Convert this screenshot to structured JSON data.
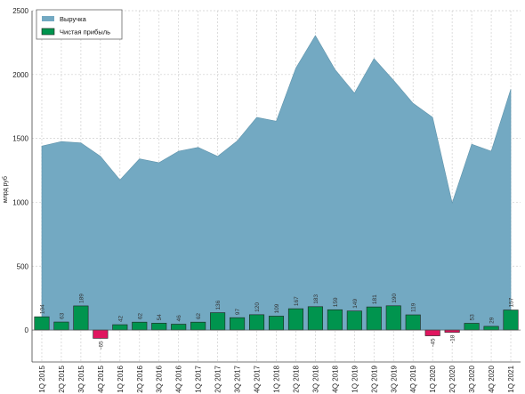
{
  "chart_data": {
    "type": "area",
    "ylabel": "млрд руб",
    "ylim": [
      -250,
      2500
    ],
    "yticks": [
      0,
      500,
      1000,
      1500,
      2000,
      2500
    ],
    "grid": true,
    "legend_position": "top-left",
    "categories": [
      "1Q 2015",
      "2Q 2015",
      "3Q 2015",
      "4Q 2015",
      "1Q 2016",
      "2Q 2016",
      "3Q 2016",
      "4Q 2016",
      "1Q 2017",
      "2Q 2017",
      "3Q 2017",
      "4Q 2017",
      "1Q 2018",
      "2Q 2018",
      "3Q 2018",
      "4Q 2018",
      "1Q 2019",
      "2Q 2019",
      "3Q 2019",
      "4Q 2019",
      "1Q 2020",
      "2Q 2020",
      "3Q 2020",
      "4Q 2020",
      "1Q 2021"
    ],
    "series": [
      {
        "name": "Выручка",
        "kind": "area",
        "color": "#73a9c2",
        "values": [
          1440,
          1475,
          1465,
          1360,
          1175,
          1340,
          1310,
          1400,
          1430,
          1360,
          1480,
          1665,
          1635,
          2050,
          2305,
          2040,
          1855,
          2125,
          1955,
          1775,
          1665,
          995,
          1455,
          1400,
          1885
        ]
      },
      {
        "name": "Чистая прибыль",
        "kind": "bar",
        "color": "#00944e",
        "negative_color": "#e0165f",
        "values": [
          104,
          63,
          189,
          -65,
          42,
          62,
          54,
          46,
          62,
          136,
          97,
          120,
          109,
          167,
          183,
          159,
          149,
          181,
          190,
          119,
          -45,
          -18,
          53,
          29,
          157
        ]
      }
    ]
  }
}
